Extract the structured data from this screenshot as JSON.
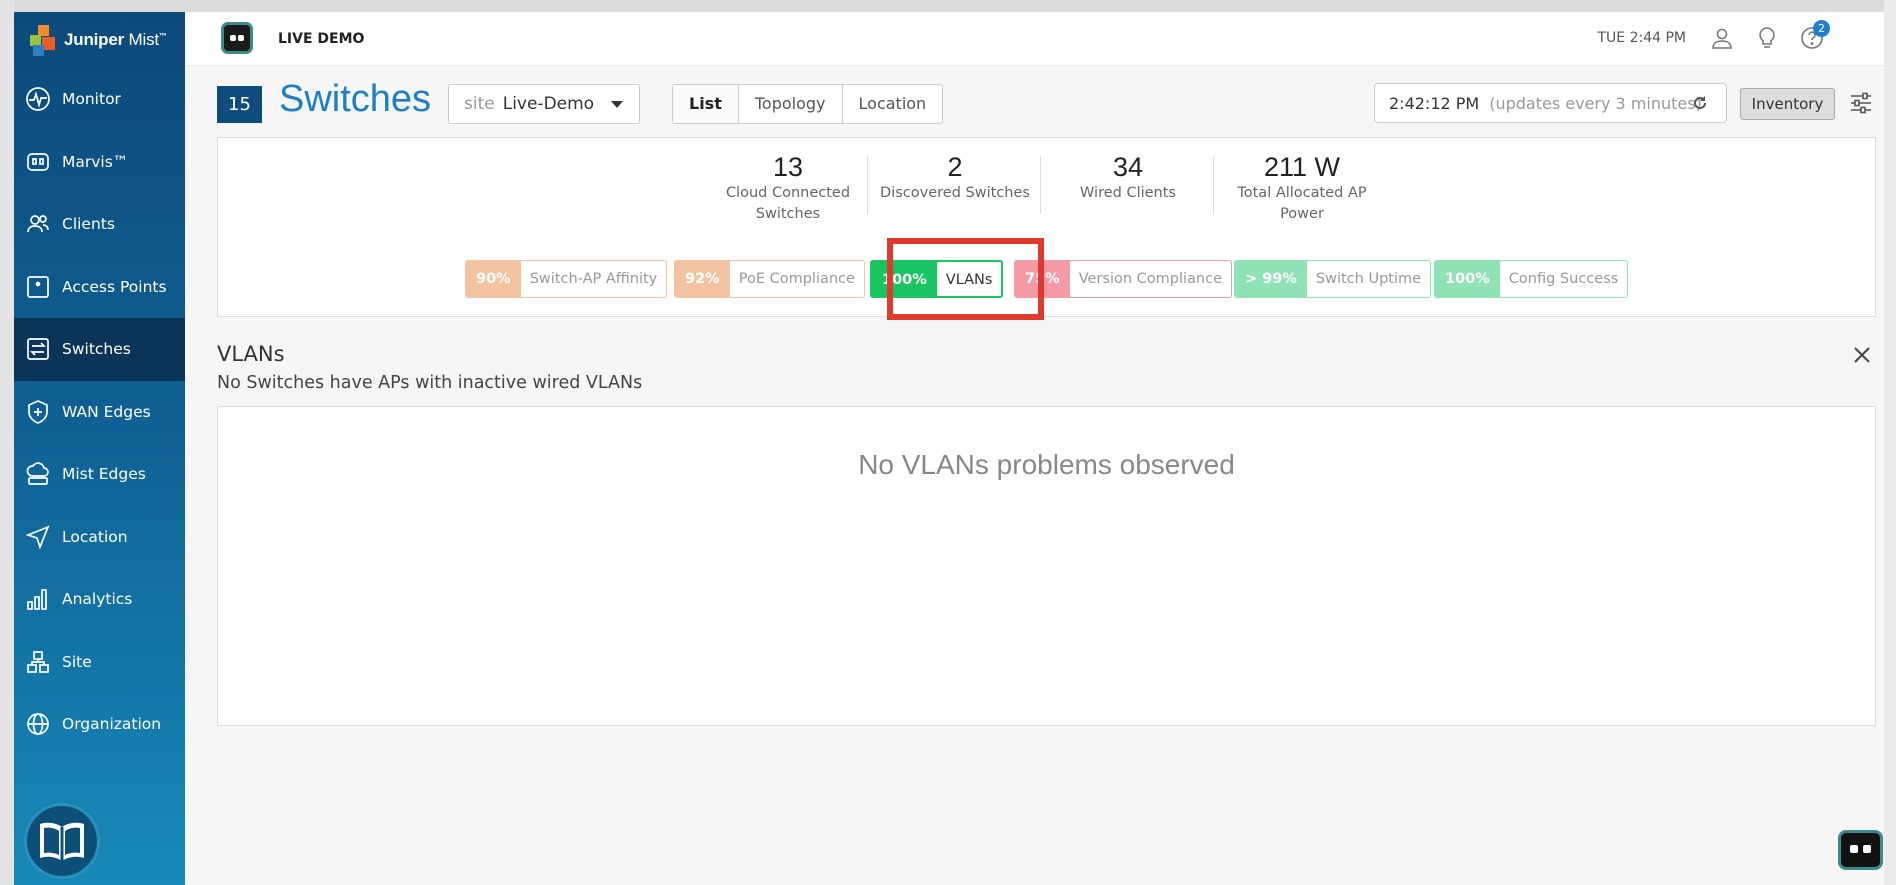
{
  "brand": {
    "name_bold": "Juniper",
    "name_light": "Mist",
    "tm": "™"
  },
  "sidebar": {
    "items": [
      {
        "label": "Monitor"
      },
      {
        "label": "Marvis™"
      },
      {
        "label": "Clients"
      },
      {
        "label": "Access Points"
      },
      {
        "label": "Switches"
      },
      {
        "label": "WAN Edges"
      },
      {
        "label": "Mist Edges"
      },
      {
        "label": "Location"
      },
      {
        "label": "Analytics"
      },
      {
        "label": "Site"
      },
      {
        "label": "Organization"
      }
    ],
    "active": "Switches"
  },
  "topbar": {
    "org": "LIVE DEMO",
    "time": "TUE 2:44 PM",
    "help_badge": "2"
  },
  "header": {
    "count": "15",
    "title": "Switches",
    "site_label": "site",
    "site_value": "Live-Demo",
    "views": [
      "List",
      "Topology",
      "Location"
    ],
    "selected_view": "List",
    "update_time": "2:42:12 PM",
    "update_note": "(updates every 3 minutes)",
    "inventory_label": "Inventory"
  },
  "stats": [
    {
      "value": "13",
      "label1": "Cloud Connected",
      "label2": "Switches"
    },
    {
      "value": "2",
      "label1": "Discovered Switches",
      "label2": ""
    },
    {
      "value": "34",
      "label1": "Wired Clients",
      "label2": ""
    },
    {
      "value": "211 W",
      "label1": "Total Allocated AP",
      "label2": "Power"
    }
  ],
  "sles": [
    {
      "pct": "90%",
      "name": "Switch-AP Affinity",
      "color": "#f2c4a2"
    },
    {
      "pct": "92%",
      "name": "PoE Compliance",
      "color": "#f2c4a2"
    },
    {
      "pct": "100%",
      "name": "VLANs",
      "color": "#18c561"
    },
    {
      "pct": "75%",
      "name": "Version Compliance",
      "color": "#f49aa5"
    },
    {
      "pct": "> 99%",
      "name": "Switch Uptime",
      "color": "#8fe3b5"
    },
    {
      "pct": "100%",
      "name": "Config Success",
      "color": "#8fe3b5"
    }
  ],
  "detail": {
    "title": "VLANs",
    "subtitle": "No Switches have APs with inactive wired VLANs",
    "empty_message": "No VLANs problems observed"
  }
}
